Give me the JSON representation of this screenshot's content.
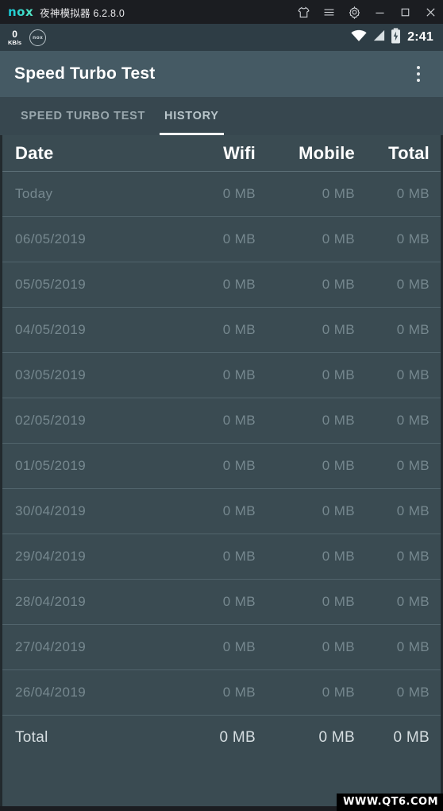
{
  "emulator": {
    "brand": "nox",
    "title": "夜神模拟器 6.2.8.0",
    "window_controls": [
      {
        "name": "skin-icon",
        "label": "Skin"
      },
      {
        "name": "menu-icon",
        "label": "Menu"
      },
      {
        "name": "gear-icon",
        "label": "Settings"
      },
      {
        "name": "minimize-icon",
        "label": "Minimize"
      },
      {
        "name": "maximize-icon",
        "label": "Maximize"
      },
      {
        "name": "close-icon",
        "label": "Close"
      }
    ]
  },
  "statusbar": {
    "speed_value": "0",
    "speed_unit": "KB/s",
    "badge_label": "nox",
    "icons": [
      "wifi-icon",
      "signal-icon",
      "battery-charging-icon"
    ],
    "time": "2:41"
  },
  "appbar": {
    "title": "Speed Turbo Test",
    "overflow_label": "More options"
  },
  "tabs": [
    {
      "label": "SPEED TURBO TEST",
      "active": false
    },
    {
      "label": "HISTORY",
      "active": true
    }
  ],
  "table": {
    "headers": [
      "Date",
      "Wifi",
      "Mobile",
      "Total"
    ],
    "rows": [
      {
        "date": "Today",
        "wifi": "0 MB",
        "mobile": "0 MB",
        "total": "0 MB"
      },
      {
        "date": "06/05/2019",
        "wifi": "0 MB",
        "mobile": "0 MB",
        "total": "0 MB"
      },
      {
        "date": "05/05/2019",
        "wifi": "0 MB",
        "mobile": "0 MB",
        "total": "0 MB"
      },
      {
        "date": "04/05/2019",
        "wifi": "0 MB",
        "mobile": "0 MB",
        "total": "0 MB"
      },
      {
        "date": "03/05/2019",
        "wifi": "0 MB",
        "mobile": "0 MB",
        "total": "0 MB"
      },
      {
        "date": "02/05/2019",
        "wifi": "0 MB",
        "mobile": "0 MB",
        "total": "0 MB"
      },
      {
        "date": "01/05/2019",
        "wifi": "0 MB",
        "mobile": "0 MB",
        "total": "0 MB"
      },
      {
        "date": "30/04/2019",
        "wifi": "0 MB",
        "mobile": "0 MB",
        "total": "0 MB"
      },
      {
        "date": "29/04/2019",
        "wifi": "0 MB",
        "mobile": "0 MB",
        "total": "0 MB"
      },
      {
        "date": "28/04/2019",
        "wifi": "0 MB",
        "mobile": "0 MB",
        "total": "0 MB"
      },
      {
        "date": "27/04/2019",
        "wifi": "0 MB",
        "mobile": "0 MB",
        "total": "0 MB"
      },
      {
        "date": "26/04/2019",
        "wifi": "0 MB",
        "mobile": "0 MB",
        "total": "0 MB"
      }
    ],
    "total_row": {
      "date": "Total",
      "wifi": "0 MB",
      "mobile": "0 MB",
      "total": "0 MB"
    }
  },
  "watermark": {
    "text": "WWW.QT6.COM"
  },
  "colors": {
    "window_chrome": "#1b1d21",
    "statusbar_bg": "#2e3d45",
    "appbar_bg": "#455a64",
    "tabbar_bg": "#37474f",
    "content_bg": "#3a4b52",
    "accent": "#ffffff",
    "brand_teal": "#1fd4d4",
    "row_text": "#76888f"
  }
}
